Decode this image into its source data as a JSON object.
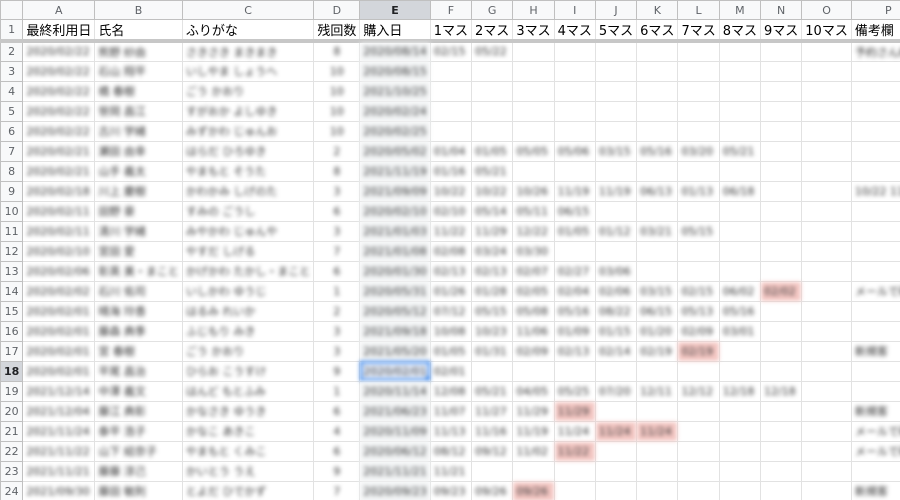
{
  "columns": [
    "A",
    "B",
    "C",
    "D",
    "E",
    "F",
    "G",
    "H",
    "I",
    "J",
    "K",
    "L",
    "M",
    "N",
    "O",
    "P"
  ],
  "header_row": {
    "number": "1",
    "cells": [
      "最終利用日",
      "氏名",
      "ふりがな",
      "残回数",
      "購入日",
      "1マス",
      "2マス",
      "3マス",
      "4マス",
      "5マス",
      "6マス",
      "7マス",
      "8マス",
      "9マス",
      "10マス",
      "備考欄"
    ]
  },
  "rows": [
    {
      "n": "2",
      "c": [
        "2020/02/22",
        "熊野 紗由",
        "さきさき まきまき",
        "8",
        "2020/08/14",
        "02/15",
        "05/22",
        "",
        "",
        "",
        "",
        "",
        "",
        "",
        "",
        "予約さん紗"
      ]
    },
    {
      "n": "3",
      "c": [
        "2020/02/22",
        "石山 翔平",
        "いしやま しょうへ",
        "10",
        "2020/08/15",
        "",
        "",
        "",
        "",
        "",
        "",
        "",
        "",
        "",
        "",
        ""
      ]
    },
    {
      "n": "4",
      "c": [
        "2020/02/22",
        "橋 春樹",
        "ごう かおり",
        "10",
        "2021/10/25",
        "",
        "",
        "",
        "",
        "",
        "",
        "",
        "",
        "",
        "",
        ""
      ]
    },
    {
      "n": "5",
      "c": [
        "2020/02/22",
        "笹岡 昌江",
        "すがおか よしゆき",
        "10",
        "2020/02/24",
        "",
        "",
        "",
        "",
        "",
        "",
        "",
        "",
        "",
        "",
        ""
      ]
    },
    {
      "n": "6",
      "c": [
        "2020/02/22",
        "古川 学緒",
        "みずかわ じゅんお",
        "10",
        "2020/02/25",
        "",
        "",
        "",
        "",
        "",
        "",
        "",
        "",
        "",
        "",
        ""
      ]
    },
    {
      "n": "7",
      "c": [
        "2020/02/21",
        "瀬田 由幸",
        "はらだ ひろゆき",
        "2",
        "2020/05/02",
        "01/04",
        "01/05",
        "05/05",
        "05/06",
        "03/15",
        "05/16",
        "03/20",
        "05/21",
        "",
        "",
        ""
      ]
    },
    {
      "n": "8",
      "c": [
        "2020/02/21",
        "山手 義太",
        "やまもと そうた",
        "8",
        "2021/11/19",
        "01/16",
        "05/21",
        "",
        "",
        "",
        "",
        "",
        "",
        "",
        "",
        ""
      ]
    },
    {
      "n": "9",
      "c": [
        "2020/02/18",
        "川上 慶樹",
        "かわかみ しげのた",
        "3",
        "2021/09/09",
        "10/22",
        "10/22",
        "10/26",
        "11/19",
        "11/19",
        "06/13",
        "01/13",
        "06/18",
        "",
        "",
        "10/22 11/19"
      ]
    },
    {
      "n": "10",
      "c": [
        "2020/02/11",
        "田野 豪",
        "すみの ごうし",
        "6",
        "2020/02/10",
        "02/10",
        "05/14",
        "05/11",
        "06/15",
        "",
        "",
        "",
        "",
        "",
        "",
        ""
      ]
    },
    {
      "n": "11",
      "c": [
        "2020/02/11",
        "清川 学緒",
        "みやかわ じゅんや",
        "3",
        "2021/01/03",
        "11/22",
        "11/29",
        "12/22",
        "01/05",
        "01/12",
        "03/21",
        "05/15",
        "",
        "",
        "",
        ""
      ]
    },
    {
      "n": "12",
      "c": [
        "2020/02/10",
        "宮田 愛",
        "やすだ しげる",
        "7",
        "2021/01/08",
        "02/08",
        "03/24",
        "03/30",
        "",
        "",
        "",
        "",
        "",
        "",
        "",
        ""
      ]
    },
    {
      "n": "13",
      "c": [
        "2020/02/06",
        "彰英 美・まこと",
        "かげかわ たかし・まこと",
        "6",
        "2020/01/30",
        "02/13",
        "02/13",
        "02/07",
        "02/27",
        "03/06",
        "",
        "",
        "",
        "",
        "",
        ""
      ]
    },
    {
      "n": "14",
      "c": [
        "2020/02/02",
        "石川 佑司",
        "いしかわ ゆうじ",
        "1",
        "2020/05/31",
        "01/26",
        "01/28",
        "02/05",
        "02/04",
        "02/06",
        "03/15",
        "02/15",
        "06/02",
        "02/02",
        "",
        "メールで確"
      ]
    },
    {
      "n": "15",
      "c": [
        "2020/02/01",
        "晴海 玲香",
        "はるみ れいか",
        "2",
        "2020/05/12",
        "07/12",
        "05/15",
        "05/08",
        "05/16",
        "08/22",
        "06/15",
        "05/13",
        "05/16",
        "",
        "",
        ""
      ]
    },
    {
      "n": "16",
      "c": [
        "2020/02/01",
        "藤森 典季",
        "ふじもり みき",
        "3",
        "2021/09/18",
        "10/08",
        "10/23",
        "11/06",
        "01/09",
        "01/15",
        "01/20",
        "02/09",
        "03/01",
        "",
        "",
        ""
      ]
    },
    {
      "n": "17",
      "c": [
        "2020/02/01",
        "宮 春樹",
        "ごう かおり",
        "3",
        "2021/05/20",
        "01/05",
        "01/31",
        "02/09",
        "02/13",
        "02/14",
        "02/19",
        "02/19",
        "",
        "",
        "",
        "新規客"
      ]
    },
    {
      "n": "18",
      "c": [
        "2020/02/01",
        "平尾 昌治",
        "ひらお こうすけ",
        "9",
        "2020/02/01",
        "02/01",
        "",
        "",
        "",
        "",
        "",
        "",
        "",
        "",
        "",
        ""
      ]
    },
    {
      "n": "19",
      "c": [
        "2021/12/14",
        "中澤 義文",
        "はんど もとふみ",
        "1",
        "2020/11/14",
        "12/08",
        "05/21",
        "04/05",
        "05/25",
        "07/20",
        "12/11",
        "12/12",
        "12/18",
        "12/18",
        "",
        ""
      ]
    },
    {
      "n": "20",
      "c": [
        "2021/12/04",
        "藤江 典彰",
        "かなさき ゆうき",
        "6",
        "2021/06/23",
        "11/07",
        "11/27",
        "11/29",
        "11/29",
        "",
        "",
        "",
        "",
        "",
        "",
        "新規客"
      ]
    },
    {
      "n": "21",
      "c": [
        "2021/11/24",
        "泰平 浩子",
        "かなこ あきこ",
        "4",
        "2020/11/09",
        "11/13",
        "11/16",
        "11/19",
        "11/24",
        "11/24",
        "11/24",
        "",
        "",
        "",
        "",
        "メールで確"
      ]
    },
    {
      "n": "22",
      "c": [
        "2021/11/22",
        "山下 結奈子",
        "やまもと くみこ",
        "6",
        "2020/06/12",
        "08/12",
        "09/12",
        "11/02",
        "11/22",
        "",
        "",
        "",
        "",
        "",
        "",
        "メールで確"
      ]
    },
    {
      "n": "23",
      "c": [
        "2021/11/21",
        "藤藤 淳己",
        "かいとう うえ",
        "9",
        "2021/11/21",
        "11/21",
        "",
        "",
        "",
        "",
        "",
        "",
        "",
        "",
        "",
        ""
      ]
    },
    {
      "n": "24",
      "c": [
        "2021/09/30",
        "藤田 敏則",
        "とよだ ひでかず",
        "7",
        "2020/09/23",
        "09/23",
        "09/26",
        "09/26",
        "",
        "",
        "",
        "",
        "",
        "",
        "",
        "新規客"
      ]
    },
    {
      "n": "25",
      "c": [
        "2021/09/28",
        "",
        "",
        "",
        "",
        "",
        "",
        "",
        "",
        "",
        "",
        "",
        "",
        "",
        "",
        ""
      ]
    }
  ],
  "highlights": [
    "14-N",
    "17-L",
    "20-I",
    "21-J",
    "21-K",
    "22-I",
    "24-H"
  ],
  "selected_cell": "18-E",
  "colors": {
    "highlight": "#f4c7c3",
    "selection": "#1a73e8",
    "header_bg": "#f8f9fa"
  }
}
